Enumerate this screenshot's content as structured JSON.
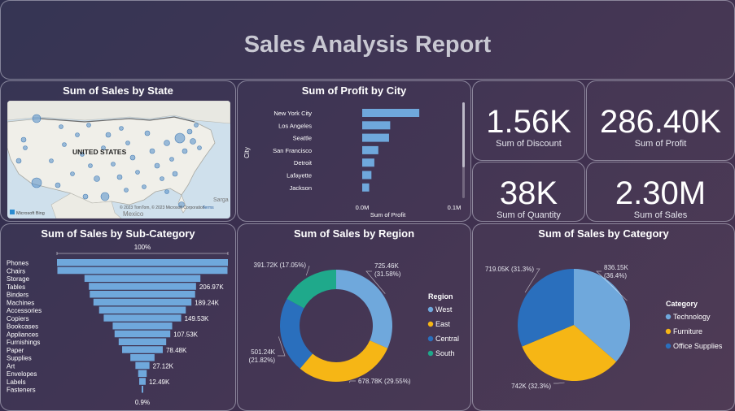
{
  "report": {
    "title": "Sales Analysis Report"
  },
  "colors": {
    "blue_light": "#6fa8dc",
    "gold": "#f6b615",
    "blue_dark": "#2a6fbd",
    "teal": "#1fa98b",
    "bar": "#6fa8dc"
  },
  "map": {
    "title": "Sum of Sales by State",
    "label": "UNITED STATES",
    "bing_label": "Microsoft Bing",
    "copyright": "© 2023 TomTom, © 2023 Microsoft Corporation",
    "terms": "Terms",
    "mexico": "Mexico",
    "sargasso": "Sarga"
  },
  "kpis": {
    "discount": {
      "value": "1.56K",
      "label": "Sum of Discount"
    },
    "profit": {
      "value": "286.40K",
      "label": "Sum of Profit"
    },
    "quantity": {
      "value": "38K",
      "label": "Sum of Quantity"
    },
    "sales": {
      "value": "2.30M",
      "label": "Sum of Sales"
    }
  },
  "chart_data": [
    {
      "type": "bar",
      "orientation": "horizontal",
      "title": "Sum of Profit by City",
      "xlabel": "Sum of Profit",
      "ylabel": "City",
      "categories": [
        "New York City",
        "Los Angeles",
        "Seattle",
        "San Francisco",
        "Detroit",
        "Lafayette",
        "Jackson"
      ],
      "values": [
        62037,
        30441,
        29156,
        17508,
        13181,
        10018,
        7581
      ],
      "xlim": [
        0,
        100000
      ],
      "xticks": [
        "0.0M",
        "0.1M"
      ]
    },
    {
      "type": "funnel",
      "title": "Sum of Sales by Sub-Category",
      "top_label": "100%",
      "bottom_label": "0.9%",
      "categories": [
        "Phones",
        "Chairs",
        "Storage",
        "Tables",
        "Binders",
        "Machines",
        "Accessories",
        "Copiers",
        "Bookcases",
        "Appliances",
        "Furnishings",
        "Paper",
        "Supplies",
        "Art",
        "Envelopes",
        "Labels",
        "Fasteners"
      ],
      "values": [
        330007,
        328449,
        223844,
        206966,
        203413,
        189239,
        167380,
        149528,
        114880,
        107532,
        91705,
        78479,
        46674,
        27119,
        16476,
        12486,
        3024
      ],
      "data_labels": [
        "",
        "",
        "",
        "206.97K",
        "",
        "189.24K",
        "",
        "149.53K",
        "",
        "107.53K",
        "",
        "78.48K",
        "",
        "27.12K",
        "",
        "12.49K",
        ""
      ]
    },
    {
      "type": "pie",
      "variant": "donut",
      "title": "Sum of Sales by Region",
      "legend_title": "Region",
      "legend_position": "right",
      "categories": [
        "West",
        "East",
        "Central",
        "South"
      ],
      "values": [
        725460,
        678780,
        501240,
        391720
      ],
      "percent": [
        31.58,
        29.55,
        21.82,
        17.05
      ],
      "data_labels": [
        "725.46K (31.58%)",
        "678.78K (29.55%)",
        "501.24K (21.82%)",
        "391.72K (17.05%)"
      ]
    },
    {
      "type": "pie",
      "title": "Sum of Sales by Category",
      "legend_title": "Category",
      "legend_position": "right",
      "categories": [
        "Technology",
        "Furniture",
        "Office Supplies"
      ],
      "values": [
        836150,
        742000,
        719050
      ],
      "percent": [
        36.4,
        32.3,
        31.3
      ],
      "data_labels": [
        "836.15K (36.4%)",
        "742K (32.3%)",
        "719.05K (31.3%)"
      ]
    }
  ]
}
